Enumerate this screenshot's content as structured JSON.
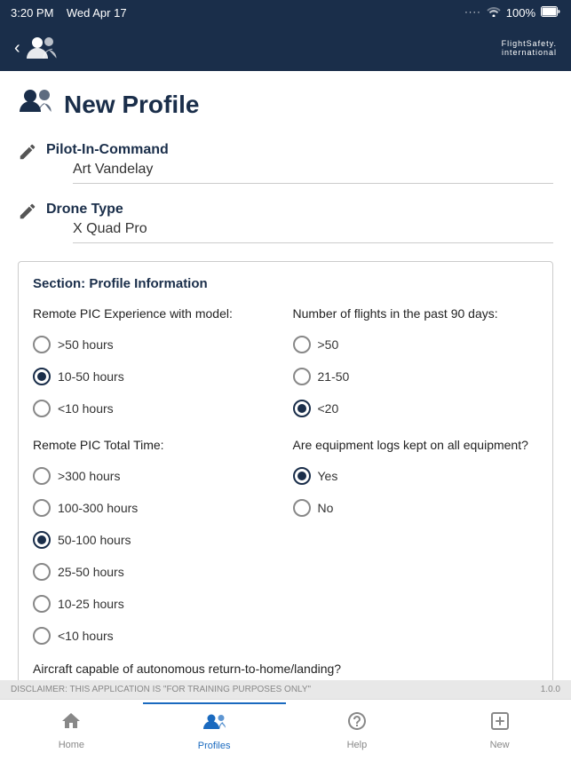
{
  "status_bar": {
    "time": "3:20 PM",
    "day": "Wed Apr 17",
    "signal": ".....",
    "wifi": "WiFi",
    "battery": "100%"
  },
  "header": {
    "back_label": "",
    "logo_name": "FlightSafety.",
    "logo_sub": "international"
  },
  "page": {
    "title": "New Profile"
  },
  "fields": {
    "pilot_label": "Pilot-In-Command",
    "pilot_value": "Art Vandelay",
    "drone_label": "Drone Type",
    "drone_value": "X Quad Pro"
  },
  "profile_section": {
    "title": "Section: Profile Information",
    "col1": {
      "label": "Remote PIC Experience with model:",
      "options": [
        {
          "id": "exp_gt50",
          "label": ">50 hours",
          "selected": false
        },
        {
          "id": "exp_10_50",
          "label": "10-50 hours",
          "selected": true
        },
        {
          "id": "exp_lt10",
          "label": "<10 hours",
          "selected": false
        }
      ]
    },
    "col2": {
      "label": "Number of flights in the past 90 days:",
      "options": [
        {
          "id": "flights_gt50",
          "label": ">50",
          "selected": false
        },
        {
          "id": "flights_21_50",
          "label": "21-50",
          "selected": false
        },
        {
          "id": "flights_lt20",
          "label": "<20",
          "selected": true
        }
      ]
    },
    "col3": {
      "label": "Remote PIC Total Time:",
      "options": [
        {
          "id": "total_gt300",
          "label": ">300 hours",
          "selected": false
        },
        {
          "id": "total_100_300",
          "label": "100-300 hours",
          "selected": false
        },
        {
          "id": "total_50_100",
          "label": "50-100 hours",
          "selected": true
        },
        {
          "id": "total_25_50",
          "label": "25-50 hours",
          "selected": false
        },
        {
          "id": "total_10_25",
          "label": "10-25 hours",
          "selected": false
        },
        {
          "id": "total_lt10",
          "label": "<10 hours",
          "selected": false
        }
      ]
    },
    "col4": {
      "label": "Are equipment logs kept on all equipment?",
      "options": [
        {
          "id": "logs_yes",
          "label": "Yes",
          "selected": true
        },
        {
          "id": "logs_no",
          "label": "No",
          "selected": false
        }
      ]
    },
    "bottom_question": "Aircraft capable of autonomous return-to-home/landing?"
  },
  "disclaimer": {
    "text": "DISCLAIMER: THIS APPLICATION IS \"FOR TRAINING PURPOSES ONLY\"",
    "version": "1.0.0"
  },
  "bottom_nav": {
    "items": [
      {
        "id": "home",
        "icon": "🏠",
        "label": "Home",
        "active": false
      },
      {
        "id": "profiles",
        "icon": "👥",
        "label": "Profiles",
        "active": true
      },
      {
        "id": "help",
        "icon": "❓",
        "label": "Help",
        "active": false
      },
      {
        "id": "new",
        "icon": "➕",
        "label": "New",
        "active": false
      }
    ]
  }
}
